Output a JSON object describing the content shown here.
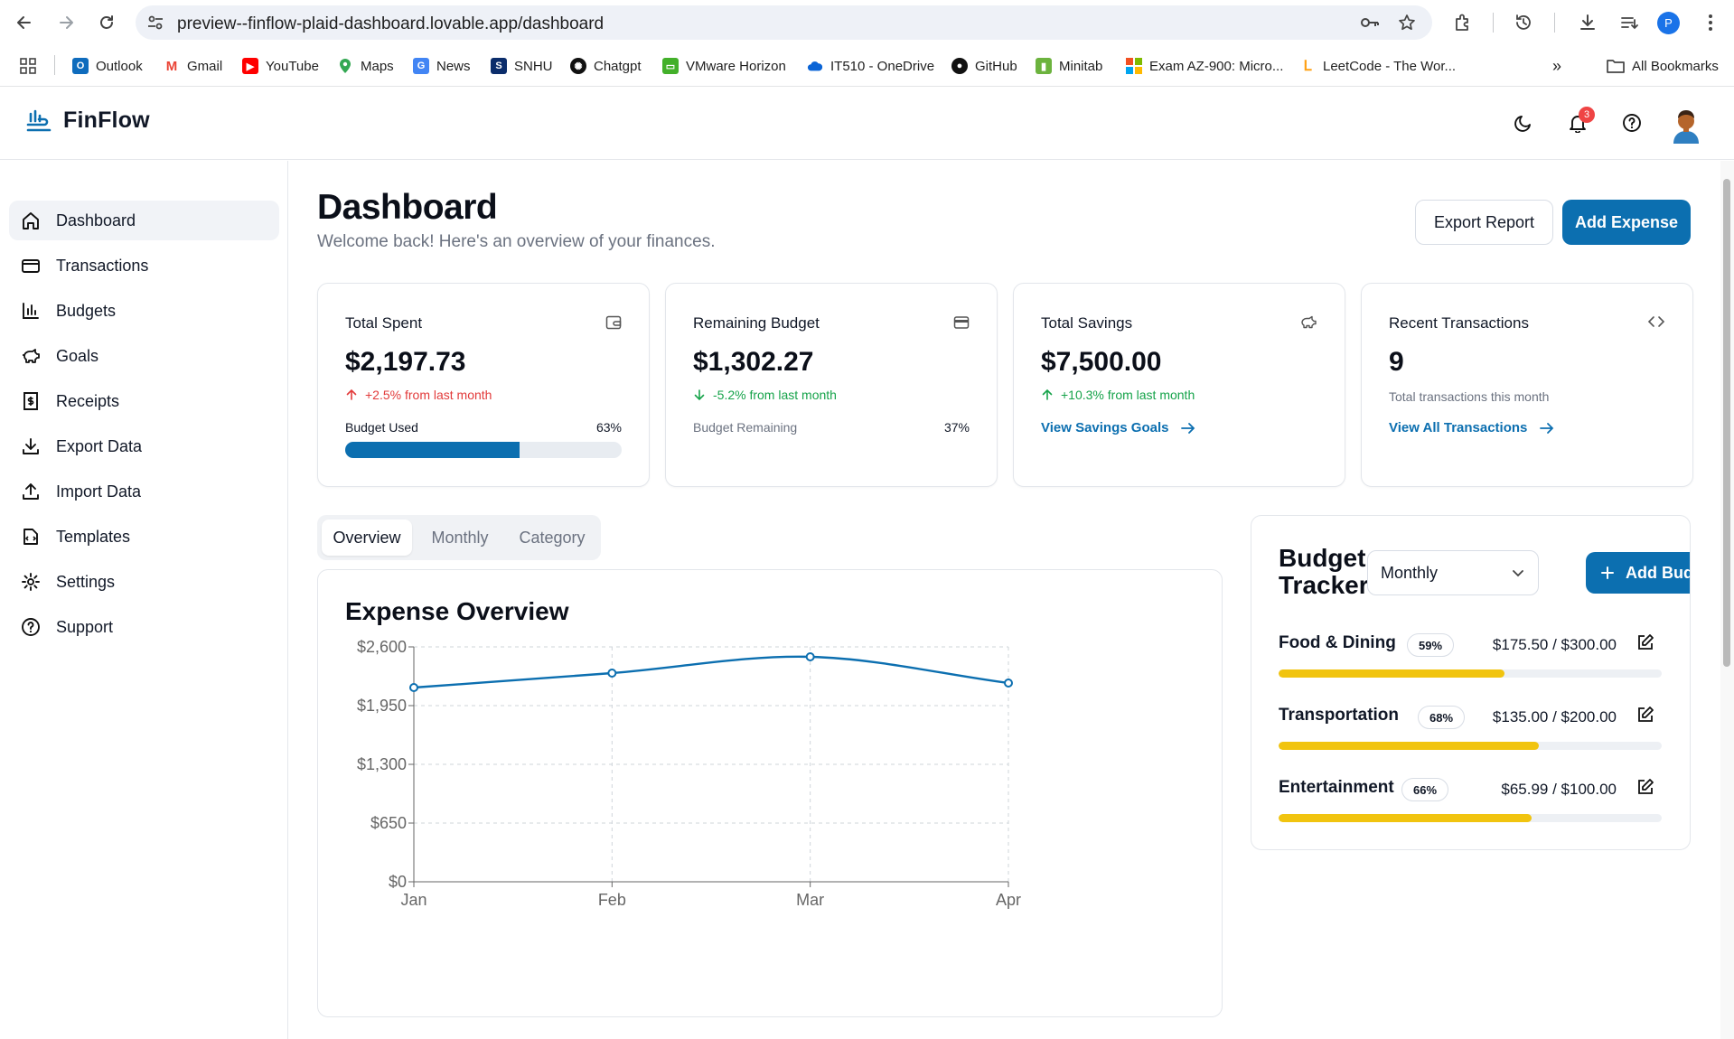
{
  "browser": {
    "url": "preview--finflow-plaid-dashboard.lovable.app/dashboard",
    "profile_initial": "P",
    "bookmarks": [
      {
        "label": "Outlook",
        "icon": "outlook-icon",
        "color": "#0f6cbd"
      },
      {
        "label": "Gmail",
        "icon": "gmail-icon",
        "color": "#ea4335"
      },
      {
        "label": "YouTube",
        "icon": "youtube-icon",
        "color": "#ff0000"
      },
      {
        "label": "Maps",
        "icon": "maps-icon",
        "color": "#34a853"
      },
      {
        "label": "News",
        "icon": "news-icon",
        "color": "#4285f4"
      },
      {
        "label": "SNHU",
        "icon": "snhu-icon",
        "color": "#0b2d6b"
      },
      {
        "label": "Chatgpt",
        "icon": "chatgpt-icon",
        "color": "#111111"
      },
      {
        "label": "VMware Horizon",
        "icon": "vmware-icon",
        "color": "#43b02a"
      },
      {
        "label": "IT510 - OneDrive",
        "icon": "onedrive-icon",
        "color": "#0a64d6"
      },
      {
        "label": "GitHub",
        "icon": "github-icon",
        "color": "#111111"
      },
      {
        "label": "Minitab",
        "icon": "minitab-icon",
        "color": "#6cb33e"
      },
      {
        "label": "Exam AZ-900: Micro...",
        "icon": "microsoft-icon",
        "color": "#f25022"
      },
      {
        "label": "LeetCode - The Wor...",
        "icon": "leetcode-icon",
        "color": "#ffa116"
      }
    ],
    "all_bookmarks": "All Bookmarks"
  },
  "app": {
    "brand": "FinFlow",
    "notifications_count": "3"
  },
  "sidebar": {
    "items": [
      {
        "label": "Dashboard",
        "icon": "home-icon",
        "active": true
      },
      {
        "label": "Transactions",
        "icon": "credit-card-icon"
      },
      {
        "label": "Budgets",
        "icon": "bar-chart-icon"
      },
      {
        "label": "Goals",
        "icon": "piggy-bank-icon"
      },
      {
        "label": "Receipts",
        "icon": "receipt-icon"
      },
      {
        "label": "Export Data",
        "icon": "download-icon"
      },
      {
        "label": "Import Data",
        "icon": "upload-icon"
      },
      {
        "label": "Templates",
        "icon": "template-icon"
      },
      {
        "label": "Settings",
        "icon": "gear-icon"
      },
      {
        "label": "Support",
        "icon": "help-circle-icon"
      }
    ]
  },
  "page": {
    "title": "Dashboard",
    "subtitle": "Welcome back! Here's an overview of your finances.",
    "export_label": "Export Report",
    "add_expense_label": "Add Expense"
  },
  "cards": {
    "total_spent": {
      "title": "Total Spent",
      "value": "$2,197.73",
      "trend": "+2.5% from last month",
      "bar_label": "Budget Used",
      "bar_pct_label": "63%",
      "bar_fraction": 0.63
    },
    "remaining": {
      "title": "Remaining Budget",
      "value": "$1,302.27",
      "trend": "-5.2% from last month",
      "label": "Budget Remaining",
      "pct_label": "37%"
    },
    "savings": {
      "title": "Total Savings",
      "value": "$7,500.00",
      "trend": "+10.3% from last month",
      "link": "View Savings Goals"
    },
    "recent": {
      "title": "Recent Transactions",
      "value": "9",
      "sub": "Total transactions this month",
      "link": "View All Transactions"
    }
  },
  "tabs": [
    {
      "label": "Overview",
      "active": true
    },
    {
      "label": "Monthly"
    },
    {
      "label": "Category"
    }
  ],
  "expense_overview": {
    "title": "Expense Overview"
  },
  "chart_data": {
    "type": "line",
    "title": "Expense Overview",
    "categories": [
      "Jan",
      "Feb",
      "Mar",
      "Apr"
    ],
    "values": [
      2150,
      2310,
      2490,
      2200
    ],
    "yticks": [
      "$0",
      "$650",
      "$1,300",
      "$1,950",
      "$2,600"
    ],
    "ylim": [
      0,
      2600
    ],
    "grid": true,
    "color": "#0c6fb0"
  },
  "budget_tracker": {
    "title": "Budget Tracker",
    "period": "Monthly",
    "add_label": "Add Budget",
    "items": [
      {
        "category": "Food & Dining",
        "percent": "59%",
        "amount": "$175.50 / $300.00",
        "fraction": 0.59
      },
      {
        "category": "Transportation",
        "percent": "68%",
        "amount": "$135.00 / $200.00",
        "fraction": 0.68
      },
      {
        "category": "Entertainment",
        "percent": "66%",
        "amount": "$65.99 / $100.00",
        "fraction": 0.66
      }
    ]
  },
  "colors": {
    "primary": "#0c6fb0",
    "danger": "#e23b3b",
    "success": "#16a34a",
    "budget_bar": "#f1c40f"
  }
}
